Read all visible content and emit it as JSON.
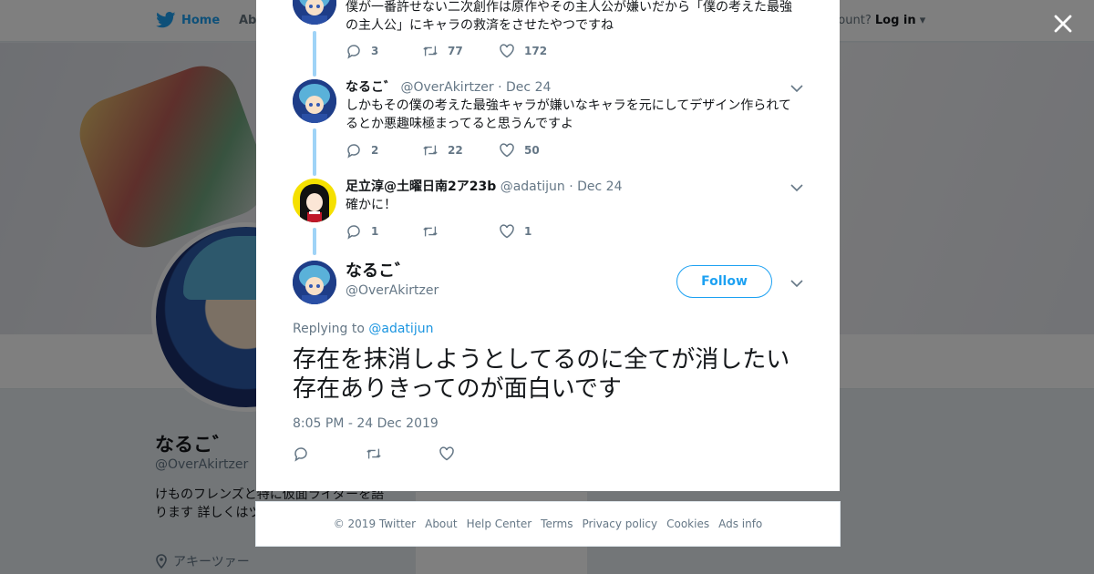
{
  "background": {
    "nav": {
      "home_label": "Home",
      "about_label": "Abo",
      "account_prompt": "ccount?",
      "login_label": "Log in"
    },
    "profile": {
      "name": "なるこ゛",
      "handle": "@OverAkirtzer",
      "bio": "けものフレンズと特に仮面ライダーを語ります 詳しくはツ 顔が悪いです",
      "location": "アキーツァー"
    }
  },
  "modal": {
    "tweets": [
      {
        "text": "僕が一番許せない二次創作は原作やその主人公が嫌いだから「僕の考えた最強の主人公」にキャラの救済をさせたやつですね",
        "replies": "3",
        "retweets": "77",
        "likes": "172"
      },
      {
        "name": "なるこ゛",
        "handle": "@OverAkirtzer",
        "date": "Dec 24",
        "text": "しかもその僕の考えた最強キャラが嫌いなキャラを元にしてデザイン作られてるとか悪趣味極まってると思うんですよ",
        "replies": "2",
        "retweets": "22",
        "likes": "50"
      },
      {
        "name": "足立淳@土曜日南2ア23b",
        "handle": "@adatijun",
        "date": "Dec 24",
        "text": "確かに！",
        "replies": "1",
        "retweets": "",
        "likes": "1"
      }
    ],
    "main_tweet": {
      "name": "なるこ゛",
      "handle": "@OverAkirtzer",
      "follow_label": "Follow",
      "replying_prefix": "Replying to",
      "replying_to": "@adatijun",
      "text": "存在を抹消しようとしてるのに全てが消したい存在ありきってのが面白いです",
      "timestamp": "8:05 PM - 24 Dec 2019"
    }
  },
  "footer": {
    "copyright": "© 2019 Twitter",
    "links": [
      "About",
      "Help Center",
      "Terms",
      "Privacy policy",
      "Cookies",
      "Ads info"
    ]
  },
  "icons": {
    "close": "close-icon",
    "reply": "reply-icon",
    "retweet": "retweet-icon",
    "like": "heart-icon",
    "caret": "chevron-down-icon",
    "bird": "twitter-bird-icon",
    "location": "location-pin-icon"
  },
  "colors": {
    "accent": "#1da1f2",
    "thread_line": "#9fd3f7",
    "muted": "#657786"
  }
}
